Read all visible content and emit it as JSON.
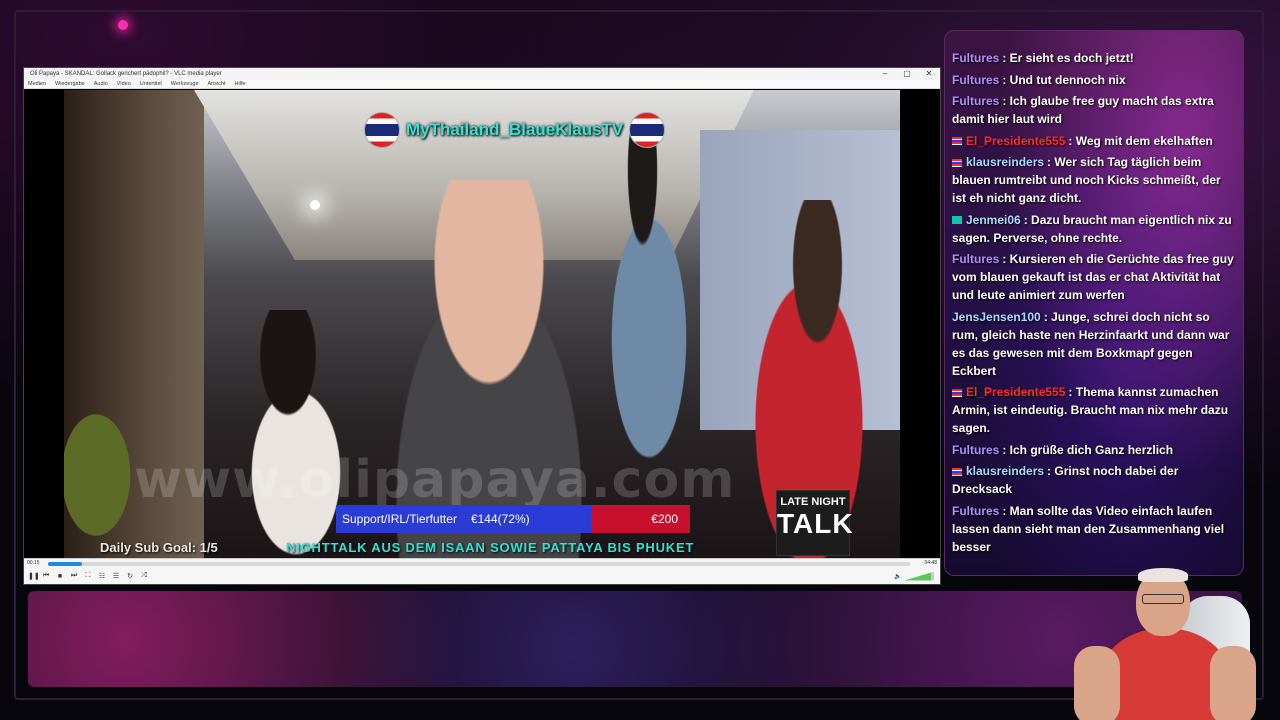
{
  "vlc": {
    "title": "Oli Papaya - SKANDAL: Gollack gerichert pädophil? - VLC media player",
    "menu": [
      "Medien",
      "Wiedergabe",
      "Audio",
      "Video",
      "Untertitel",
      "Werkzeuge",
      "Ansicht",
      "Hilfe"
    ],
    "time_elapsed": "00:15",
    "time_total": "04:48",
    "progress_fraction": 0.04,
    "volume_percent": 90,
    "controls": {
      "play_pause": "❚❚",
      "prev": "⏮",
      "stop": "■",
      "next": "⏭",
      "fullscreen": "⛶",
      "extended": "☷",
      "playlist": "☰",
      "loop": "↻",
      "random": "⤮"
    }
  },
  "video": {
    "channel_name": "MyThailand_BlaueKlausTV",
    "watermark": "www.olipapaya.com",
    "goal": {
      "label": "Support/IRL/Tierfutter",
      "current": "€144(72%)",
      "target": "€200",
      "fraction": 0.72
    },
    "sub_goal": "Daily Sub Goal: 1/5",
    "ticker": "NIGHTTALK AUS DEM ISAAN SOWIE PATTAYA BIS PHUKET",
    "logo_line1": "LATE NIGHT",
    "logo_line2": "TALK"
  },
  "chat": {
    "messages": [
      {
        "user": "Fultures",
        "color": "#b38cff",
        "badge": "",
        "text": ": Er sieht es doch jetzt!"
      },
      {
        "user": "Fultures",
        "color": "#b38cff",
        "badge": "",
        "text": ": Und tut dennoch nix"
      },
      {
        "user": "Fultures",
        "color": "#b38cff",
        "badge": "",
        "text": ": Ich glaube free guy macht das extra damit hier laut wird"
      },
      {
        "user": "El_Presidente555",
        "color": "#ff2b2b",
        "badge": "flag",
        "text": ": Weg mit dem ekelhaften"
      },
      {
        "user": "klausreinders",
        "color": "#a8d8ff",
        "badge": "flag",
        "text": ": Wer sich Tag täglich beim blauen rumtreibt und noch Kicks schmeißt, der ist eh nicht ganz dicht."
      },
      {
        "user": "Jenmei06",
        "color": "#a8d8ff",
        "badge": "green",
        "text": ": Dazu braucht man eigentlich nix zu sagen. Perverse, ohne rechte."
      },
      {
        "user": "Fultures",
        "color": "#b38cff",
        "badge": "",
        "text": ": Kursieren eh die Gerüchte das free guy vom blauen gekauft ist das er chat Aktivität hat und leute animiert zum werfen"
      },
      {
        "user": "JensJensen100",
        "color": "#a8d8ff",
        "badge": "",
        "text": ": Junge, schrei doch nicht so rum, gleich haste nen Herzinfaarkt und dann war es das gewesen mit dem Boxkmapf gegen Eckbert"
      },
      {
        "user": "El_Presidente555",
        "color": "#ff2b2b",
        "badge": "flag",
        "text": ": Thema kannst zumachen Armin, ist eindeutig. Braucht man nix mehr dazu sagen."
      },
      {
        "user": "Fultures",
        "color": "#b38cff",
        "badge": "",
        "text": ": Ich grüße dich Ganz herzlich"
      },
      {
        "user": "klausreinders",
        "color": "#a8d8ff",
        "badge": "flag",
        "text": ": Grinst noch dabei der Drecksack"
      },
      {
        "user": "Fultures",
        "color": "#b38cff",
        "badge": "",
        "text": ": Man sollte das Video einfach laufen lassen dann sieht man den Zusammenhang viel besser"
      }
    ]
  }
}
